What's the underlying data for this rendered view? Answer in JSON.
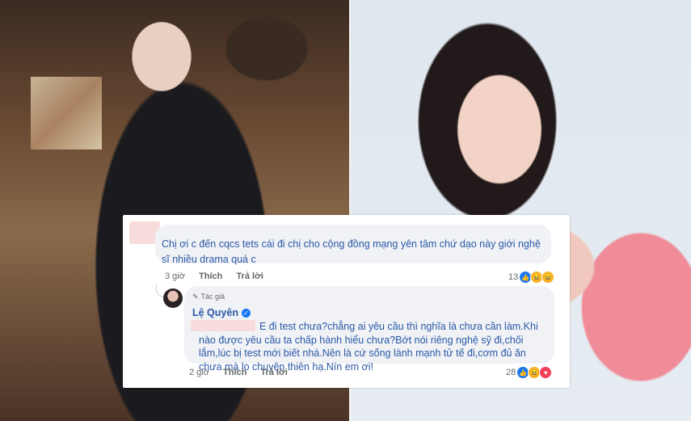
{
  "comment": {
    "text": "Chị ơi c đến cqcs tets cái đi chị cho cộng đồng mạng yên tâm chứ dạo này giới nghệ sĩ nhiều drama quá c",
    "time": "3 giờ",
    "like_label": "Thích",
    "reply_label": "Trả lời",
    "reaction_count": "13"
  },
  "reply": {
    "author_badge": "Tác giả",
    "author_name": "Lệ Quyên",
    "text": "E đi test chưa?chẳng ai yêu cầu thì nghĩa là chưa cần làm.Khi nào được yêu cầu ta chấp hành hiểu chưa?Bớt nói riêng nghệ sỹ đi,chối lắm,lúc bị test mới biết nhá.Nên là cứ sống lành mạnh tử tế đi,cơm đủ ăn chưa mà lo chuyện thiên hạ.Nín em ơi!",
    "time": "2 giờ",
    "like_label": "Thích",
    "reply_label": "Trả lời",
    "reaction_count": "28"
  },
  "icons": {
    "like": "like-reaction-icon",
    "haha": "haha-reaction-icon",
    "love": "love-reaction-icon",
    "verified": "verified-badge-icon",
    "pencil": "pencil-icon"
  },
  "colors": {
    "link_text": "#2a58a8",
    "bubble_bg": "#f0f2f5",
    "meta_text": "#65676b",
    "like": "#1877f2",
    "love": "#f33e58",
    "haha": "#f7b125"
  }
}
